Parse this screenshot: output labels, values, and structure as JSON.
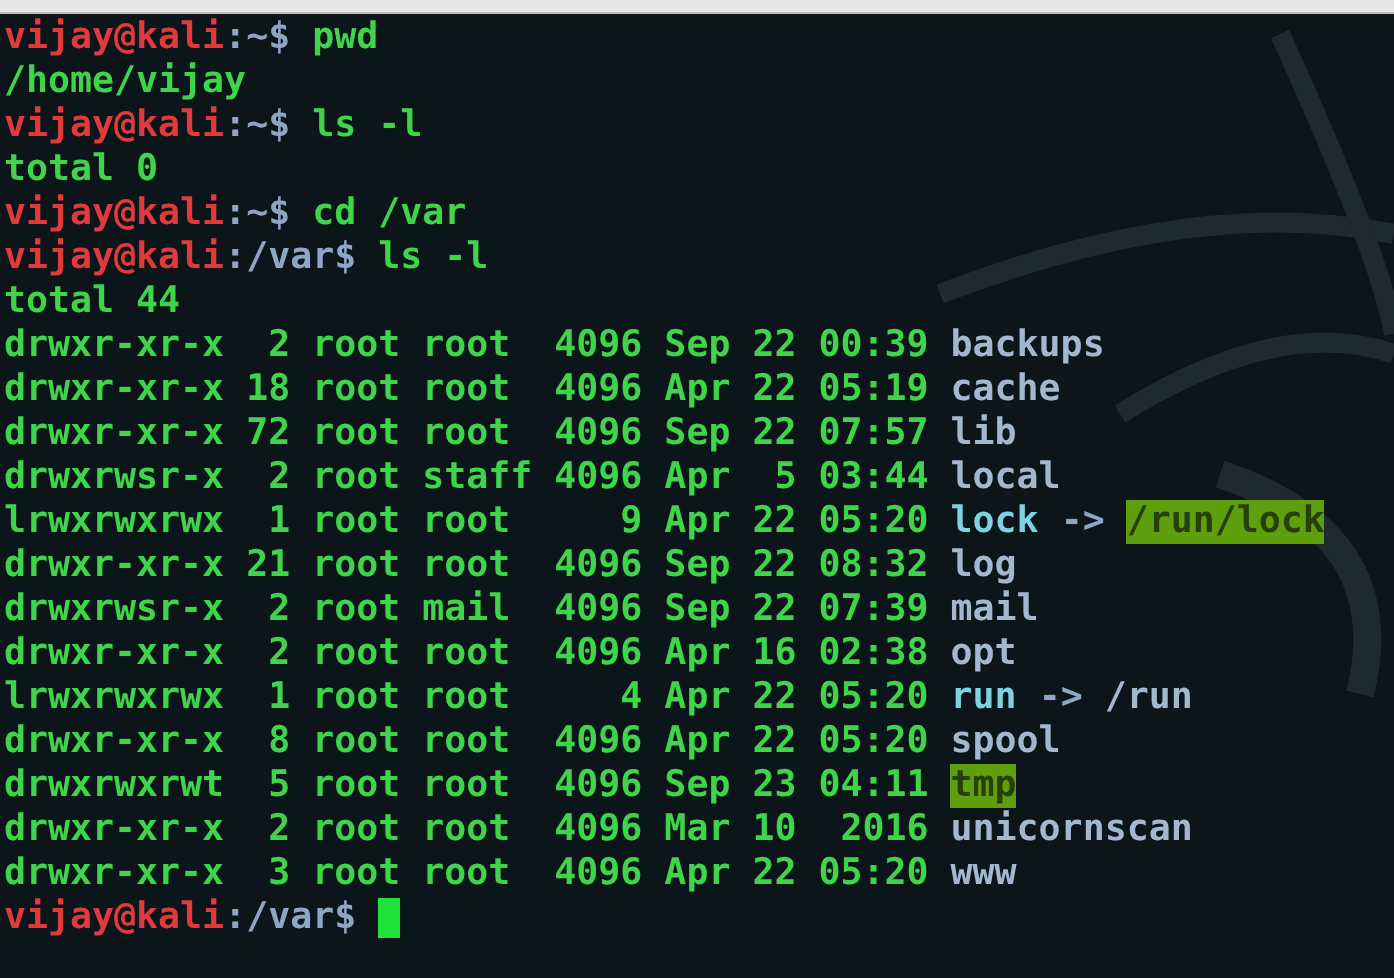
{
  "terminal": {
    "lines": [
      {
        "kind": "prompt",
        "user_host": "vijay@kali",
        "separator": ":",
        "path": "~",
        "symbol": "$",
        "command": "pwd",
        "cursor": false
      },
      {
        "kind": "output",
        "text": "/home/vijay"
      },
      {
        "kind": "prompt",
        "user_host": "vijay@kali",
        "separator": ":",
        "path": "~",
        "symbol": "$",
        "command": "ls -l",
        "cursor": false
      },
      {
        "kind": "output",
        "text": "total 0"
      },
      {
        "kind": "prompt",
        "user_host": "vijay@kali",
        "separator": ":",
        "path": "~",
        "symbol": "$",
        "command": "cd /var",
        "cursor": false
      },
      {
        "kind": "prompt",
        "user_host": "vijay@kali",
        "separator": ":",
        "path": "/var",
        "symbol": "$",
        "command": "ls -l",
        "cursor": false
      },
      {
        "kind": "output",
        "text": "total 44"
      },
      {
        "kind": "entry",
        "meta": "drwxr-xr-x  2 root root  4096 Sep 22 00:39",
        "name": {
          "text": "backups",
          "kind": "dir"
        }
      },
      {
        "kind": "entry",
        "meta": "drwxr-xr-x 18 root root  4096 Apr 22 05:19",
        "name": {
          "text": "cache",
          "kind": "dir"
        }
      },
      {
        "kind": "entry",
        "meta": "drwxr-xr-x 72 root root  4096 Sep 22 07:57",
        "name": {
          "text": "lib",
          "kind": "dir"
        }
      },
      {
        "kind": "entry",
        "meta": "drwxrwsr-x  2 root staff 4096 Apr  5 03:44",
        "name": {
          "text": "local",
          "kind": "dir"
        }
      },
      {
        "kind": "entry",
        "meta": "lrwxrwxrwx  1 root root     9 Apr 22 05:20",
        "name": {
          "text": "lock",
          "kind": "link"
        },
        "arrow": "->",
        "target": {
          "text": "/run/lock",
          "kind": "sticky"
        }
      },
      {
        "kind": "entry",
        "meta": "drwxr-xr-x 21 root root  4096 Sep 22 08:32",
        "name": {
          "text": "log",
          "kind": "dir"
        }
      },
      {
        "kind": "entry",
        "meta": "drwxrwsr-x  2 root mail  4096 Sep 22 07:39",
        "name": {
          "text": "mail",
          "kind": "dir"
        }
      },
      {
        "kind": "entry",
        "meta": "drwxr-xr-x  2 root root  4096 Apr 16 02:38",
        "name": {
          "text": "opt",
          "kind": "dir"
        }
      },
      {
        "kind": "entry",
        "meta": "lrwxrwxrwx  1 root root     4 Apr 22 05:20",
        "name": {
          "text": "run",
          "kind": "link"
        },
        "arrow": "->",
        "target": {
          "text": "/run",
          "kind": "dir"
        }
      },
      {
        "kind": "entry",
        "meta": "drwxr-xr-x  8 root root  4096 Apr 22 05:20",
        "name": {
          "text": "spool",
          "kind": "dir"
        }
      },
      {
        "kind": "entry",
        "meta": "drwxrwxrwt  5 root root  4096 Sep 23 04:11",
        "name": {
          "text": "tmp",
          "kind": "sticky"
        }
      },
      {
        "kind": "entry",
        "meta": "drwxr-xr-x  2 root root  4096 Mar 10  2016",
        "name": {
          "text": "unicornscan",
          "kind": "dir"
        }
      },
      {
        "kind": "entry",
        "meta": "drwxr-xr-x  3 root root  4096 Apr 22 05:20",
        "name": {
          "text": "www",
          "kind": "dir"
        }
      },
      {
        "kind": "prompt",
        "user_host": "vijay@kali",
        "separator": ":",
        "path": "/var",
        "symbol": "$",
        "cursor": true
      }
    ]
  }
}
